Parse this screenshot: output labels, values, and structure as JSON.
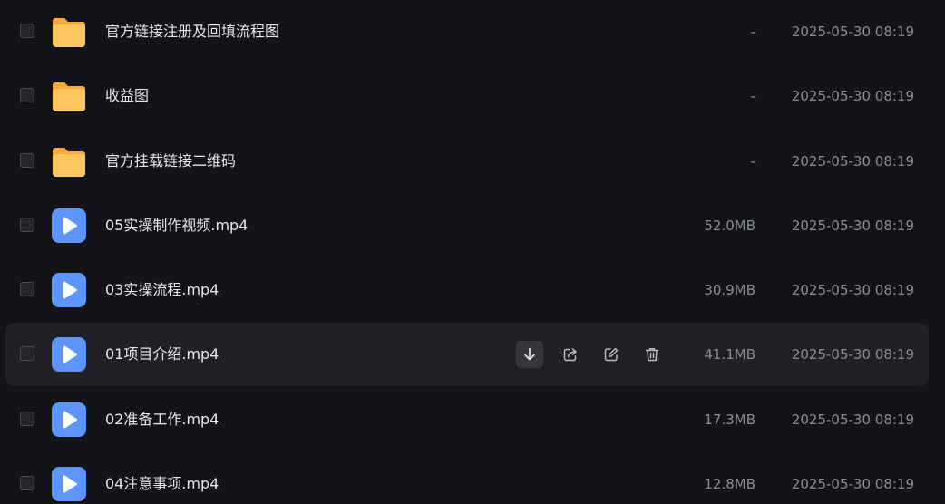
{
  "files": [
    {
      "name": "官方链接注册及回填流程图",
      "type": "folder",
      "size": "-",
      "modified": "2025-05-30 08:19"
    },
    {
      "name": "收益图",
      "type": "folder",
      "size": "-",
      "modified": "2025-05-30 08:19"
    },
    {
      "name": "官方挂载链接二维码",
      "type": "folder",
      "size": "-",
      "modified": "2025-05-30 08:19"
    },
    {
      "name": "05实操制作视频.mp4",
      "type": "video",
      "size": "52.0MB",
      "modified": "2025-05-30 08:19"
    },
    {
      "name": "03实操流程.mp4",
      "type": "video",
      "size": "30.9MB",
      "modified": "2025-05-30 08:19"
    },
    {
      "name": "01项目介绍.mp4",
      "type": "video",
      "size": "41.1MB",
      "modified": "2025-05-30 08:19",
      "hovered": true
    },
    {
      "name": "02准备工作.mp4",
      "type": "video",
      "size": "17.3MB",
      "modified": "2025-05-30 08:19"
    },
    {
      "name": "04注意事项.mp4",
      "type": "video",
      "size": "12.8MB",
      "modified": "2025-05-30 08:19"
    }
  ],
  "row_actions": [
    "download-icon",
    "share-icon",
    "edit-icon",
    "delete-icon"
  ],
  "colors": {
    "background": "#131417",
    "hover_row": "#202124",
    "folder_icon": "#FFC760",
    "video_icon": "#5E95FA",
    "text_primary": "#e6e7ea",
    "text_secondary": "#8a8d94"
  }
}
